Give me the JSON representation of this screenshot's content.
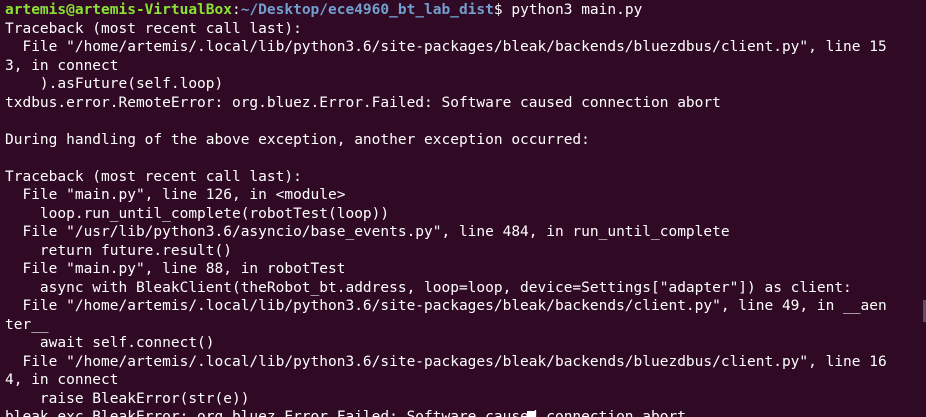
{
  "prompt": {
    "user_host": "artemis@artemis-VirtualBox",
    "separator": ":",
    "path": "~/Desktop/ece4960_bt_lab_dist",
    "symbol": "$ ",
    "command": "python3 main.py"
  },
  "output_lines": [
    "Traceback (most recent call last):",
    "  File \"/home/artemis/.local/lib/python3.6/site-packages/bleak/backends/bluezdbus/client.py\", line 15",
    "3, in connect",
    "    ).asFuture(self.loop)",
    "txdbus.error.RemoteError: org.bluez.Error.Failed: Software caused connection abort",
    "",
    "During handling of the above exception, another exception occurred:",
    "",
    "Traceback (most recent call last):",
    "  File \"main.py\", line 126, in <module>",
    "    loop.run_until_complete(robotTest(loop))",
    "  File \"/usr/lib/python3.6/asyncio/base_events.py\", line 484, in run_until_complete",
    "    return future.result()",
    "  File \"main.py\", line 88, in robotTest",
    "    async with BleakClient(theRobot_bt.address, loop=loop, device=Settings[\"adapter\"]) as client:",
    "  File \"/home/artemis/.local/lib/python3.6/site-packages/bleak/backends/client.py\", line 49, in __aen",
    "ter__",
    "    await self.connect()",
    "  File \"/home/artemis/.local/lib/python3.6/site-packages/bleak/backends/bluezdbus/client.py\", line 16",
    "4, in connect",
    "    raise BleakError(str(e))",
    "bleak.exc.BleakError: org.bluez.Error.Failed: Software caused connection abort"
  ],
  "colors": {
    "background": "#300a24",
    "text": "#ffffff",
    "user_host": "#8ae234",
    "path": "#729fcf"
  }
}
